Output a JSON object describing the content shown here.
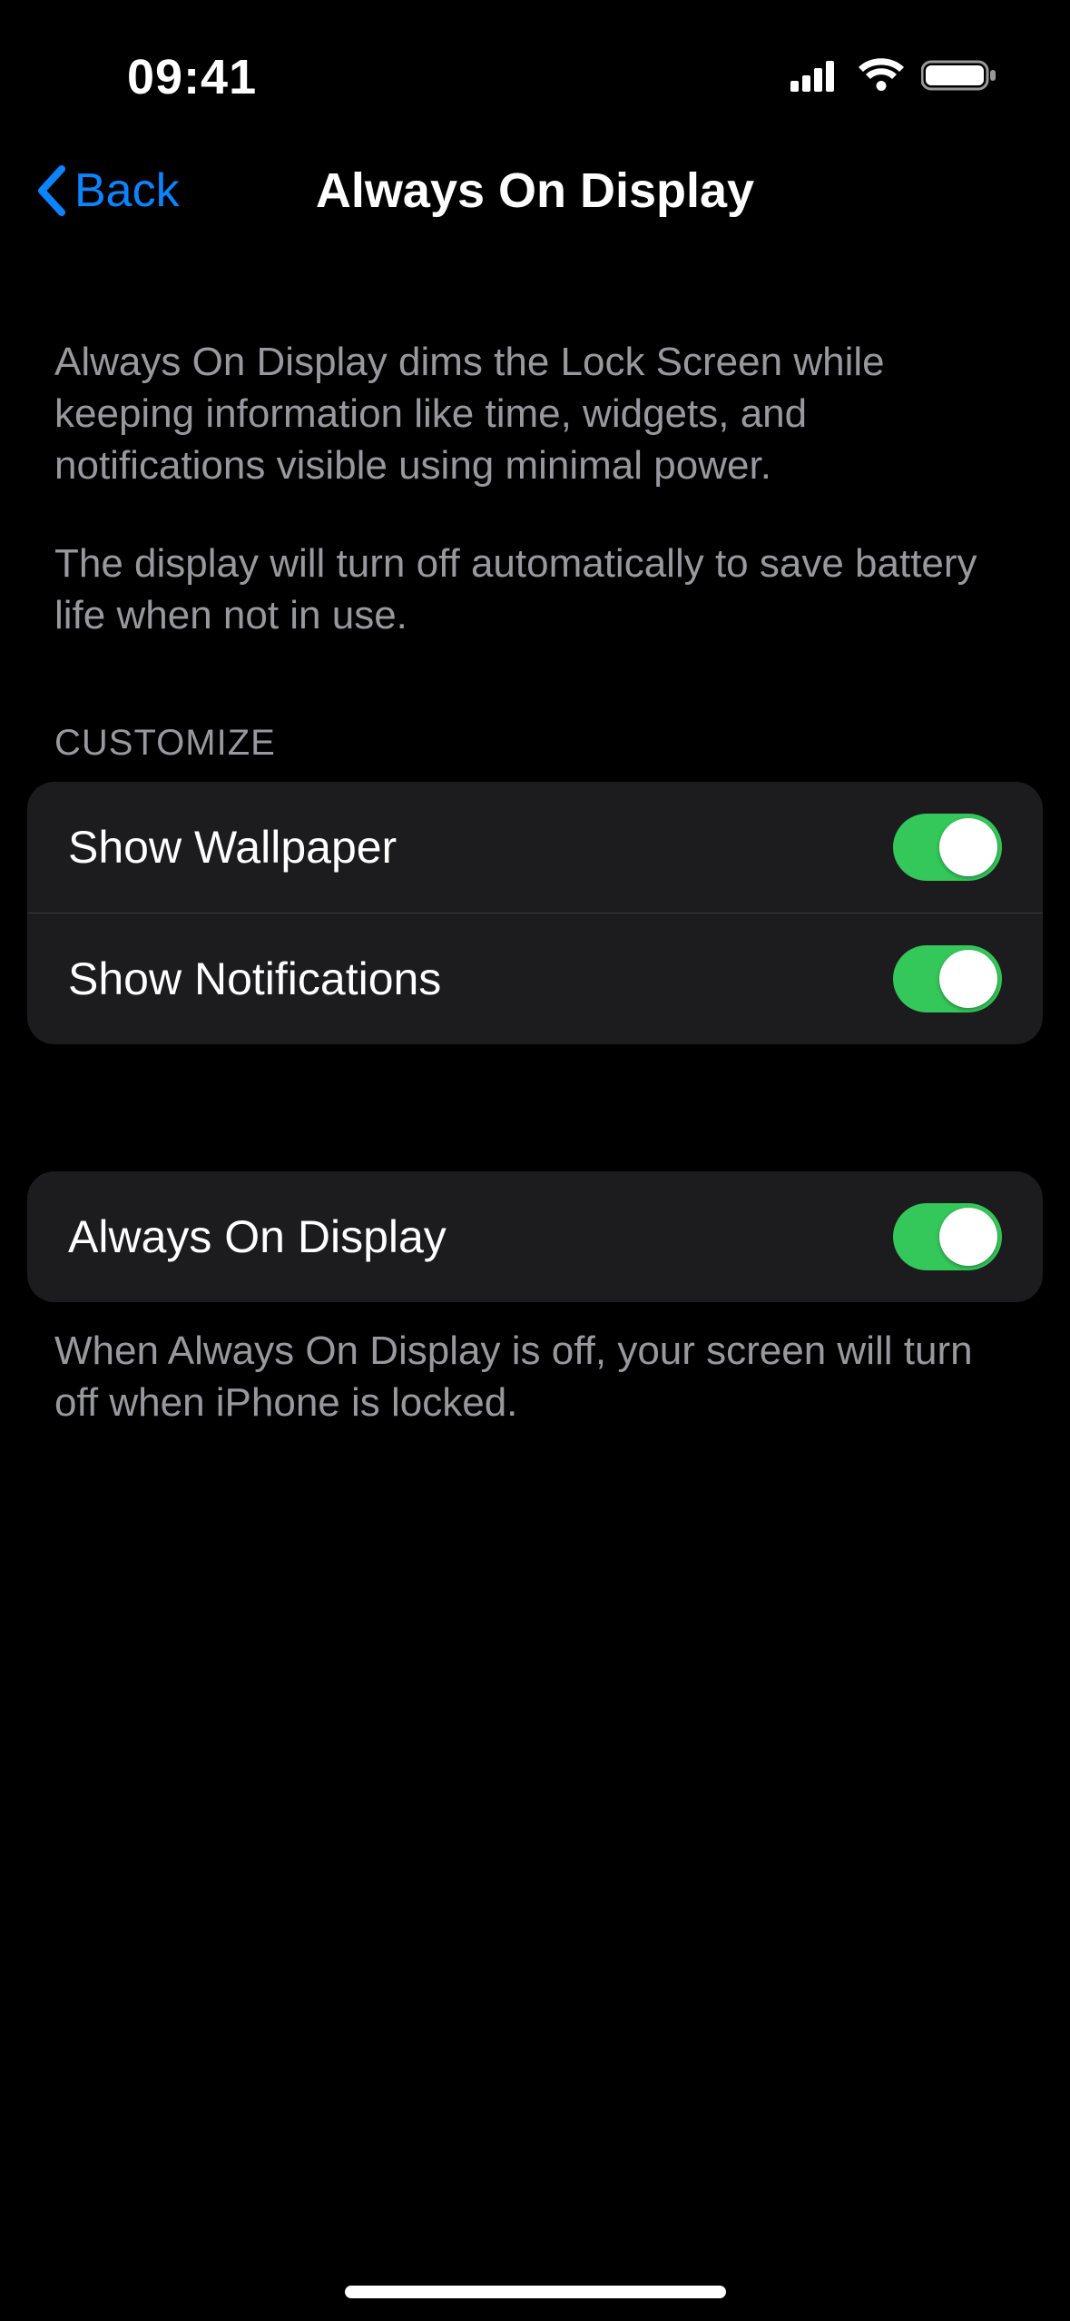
{
  "statusbar": {
    "time": "09:41"
  },
  "nav": {
    "back": "Back",
    "title": "Always On Display"
  },
  "description": {
    "p1": "Always On Display dims the Lock Screen while keeping information like time, widgets, and notifications visible using minimal power.",
    "p2": "The display will turn off automatically to save battery life when not in use."
  },
  "customize": {
    "header": "CUSTOMIZE",
    "items": [
      {
        "label": "Show Wallpaper",
        "on": true
      },
      {
        "label": "Show Notifications",
        "on": true
      }
    ]
  },
  "main": {
    "items": [
      {
        "label": "Always On Display",
        "on": true
      }
    ],
    "footer": "When Always On Display is off, your screen will turn off when iPhone is locked."
  },
  "colors": {
    "accent": "#0a84ff",
    "switch_on": "#34c759"
  }
}
